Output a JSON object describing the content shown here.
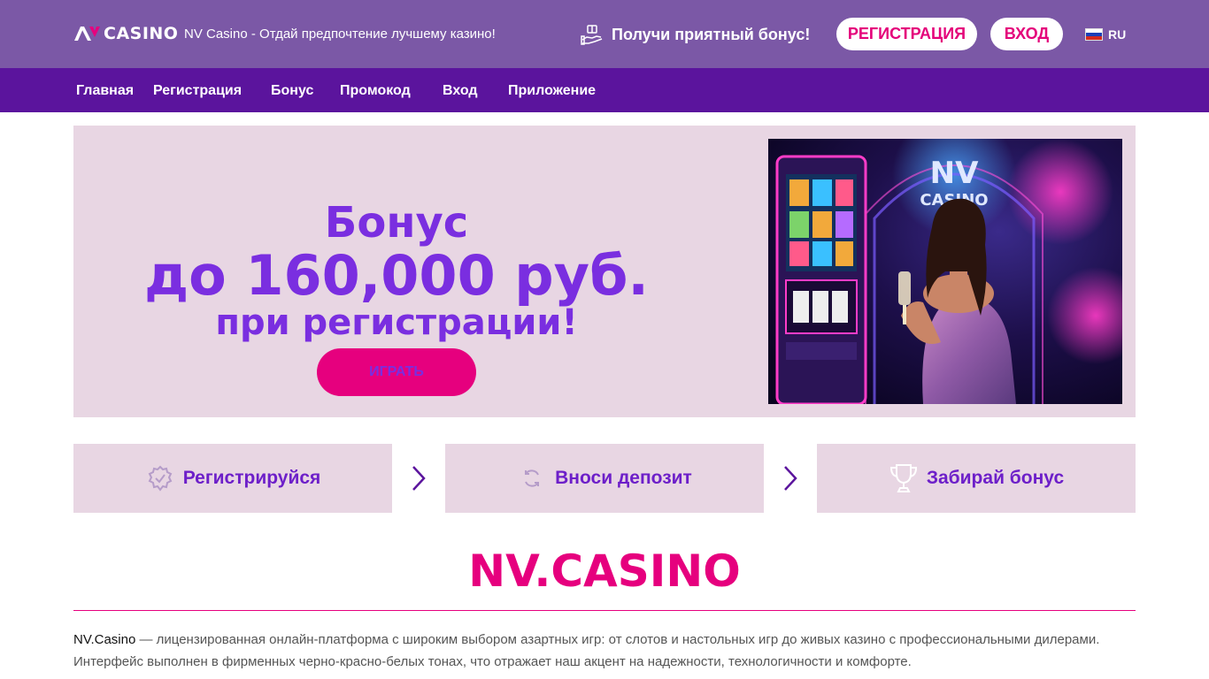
{
  "header": {
    "logo_text": "CASINO",
    "logo_mark": "NV",
    "tagline": "NV Casino - Отдай предпочтение лучшему казино!",
    "bonus_cta": "Получи приятный бонус!",
    "register_button": "Регистрация",
    "login_button": "Вход",
    "language": "RU"
  },
  "nav": {
    "items": [
      "Главная",
      "Регистрация",
      "Бонус",
      "Промокод",
      "Вход",
      "Приложение"
    ]
  },
  "hero": {
    "line1": "Бонус",
    "line2": "до 160,000 руб.",
    "line3": "при регистрации!",
    "play_button": "Играть"
  },
  "steps": [
    {
      "label": "Регистрируйся",
      "icon": "check-badge-icon"
    },
    {
      "label": "Вноси депозит",
      "icon": "refresh-icon"
    },
    {
      "label": "Забирай бонус",
      "icon": "trophy-icon"
    }
  ],
  "content": {
    "title": "NV.CASINO",
    "brand": "NV.Casino",
    "description": " — лицензированная онлайн-платформа с широким выбором азартных игр: от слотов и настольных игр до живых казино с профессиональными дилерами. Интерфейс выполнен в фирменных черно-красно-белых тонах, что отражает наш акцент на надежности, технологичности и комфорте."
  },
  "colors": {
    "topbar": "#7b58a6",
    "navbar": "#5b149d",
    "accent_pink": "#e6007e",
    "accent_purple": "#7a2ee0",
    "panel": "#e8d6e3"
  }
}
